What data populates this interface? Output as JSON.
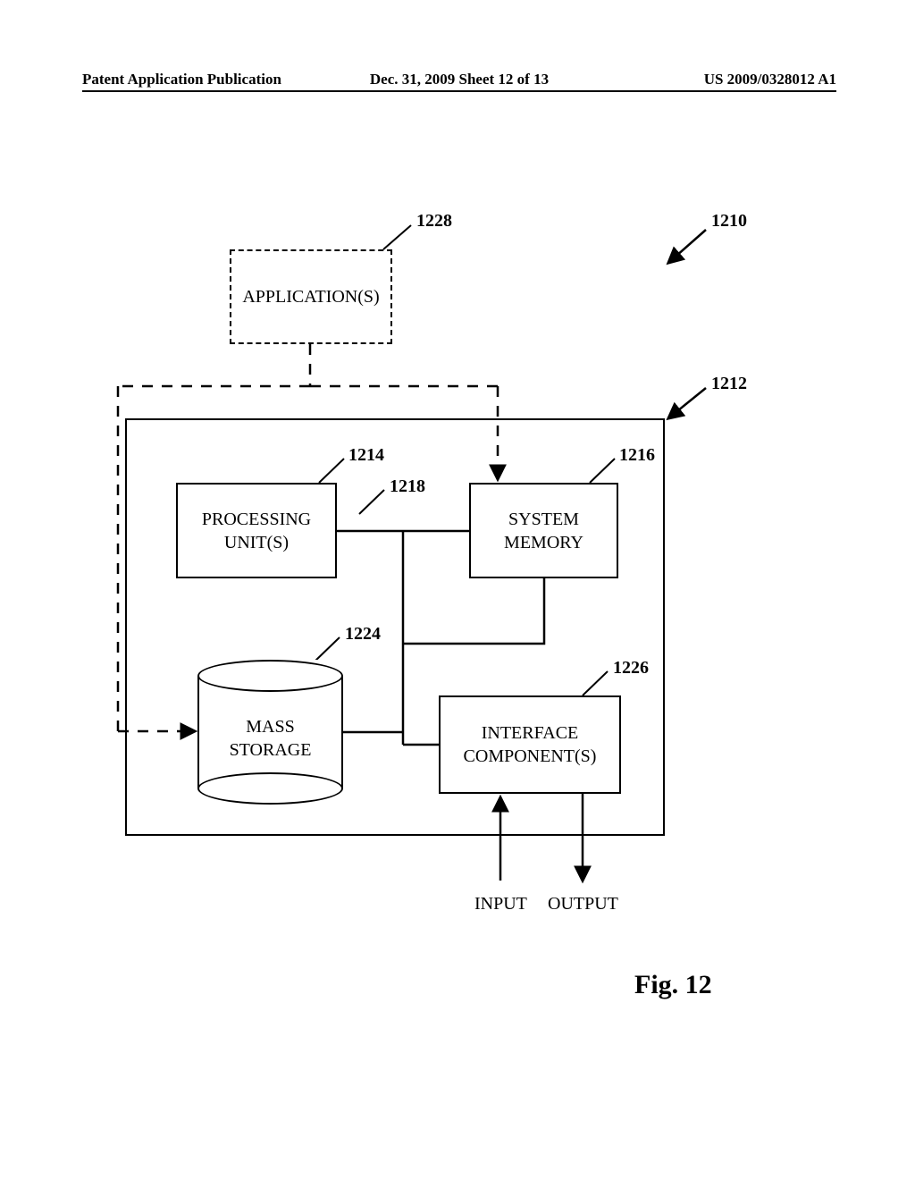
{
  "header": {
    "left": "Patent Application Publication",
    "mid": "Dec. 31, 2009  Sheet 12 of 13",
    "right": "US 2009/0328012 A1"
  },
  "blocks": {
    "applications": "APPLICATION(S)",
    "processing": "PROCESSING\nUNIT(S)",
    "memory": "SYSTEM\nMEMORY",
    "storage": "MASS\nSTORAGE",
    "interface": "INTERFACE\nCOMPONENT(S)"
  },
  "refs": {
    "r1210": "1210",
    "r1212": "1212",
    "r1214": "1214",
    "r1216": "1216",
    "r1218": "1218",
    "r1224": "1224",
    "r1226": "1226",
    "r1228": "1228"
  },
  "io": {
    "input": "INPUT",
    "output": "OUTPUT"
  },
  "figure": "Fig. 12"
}
